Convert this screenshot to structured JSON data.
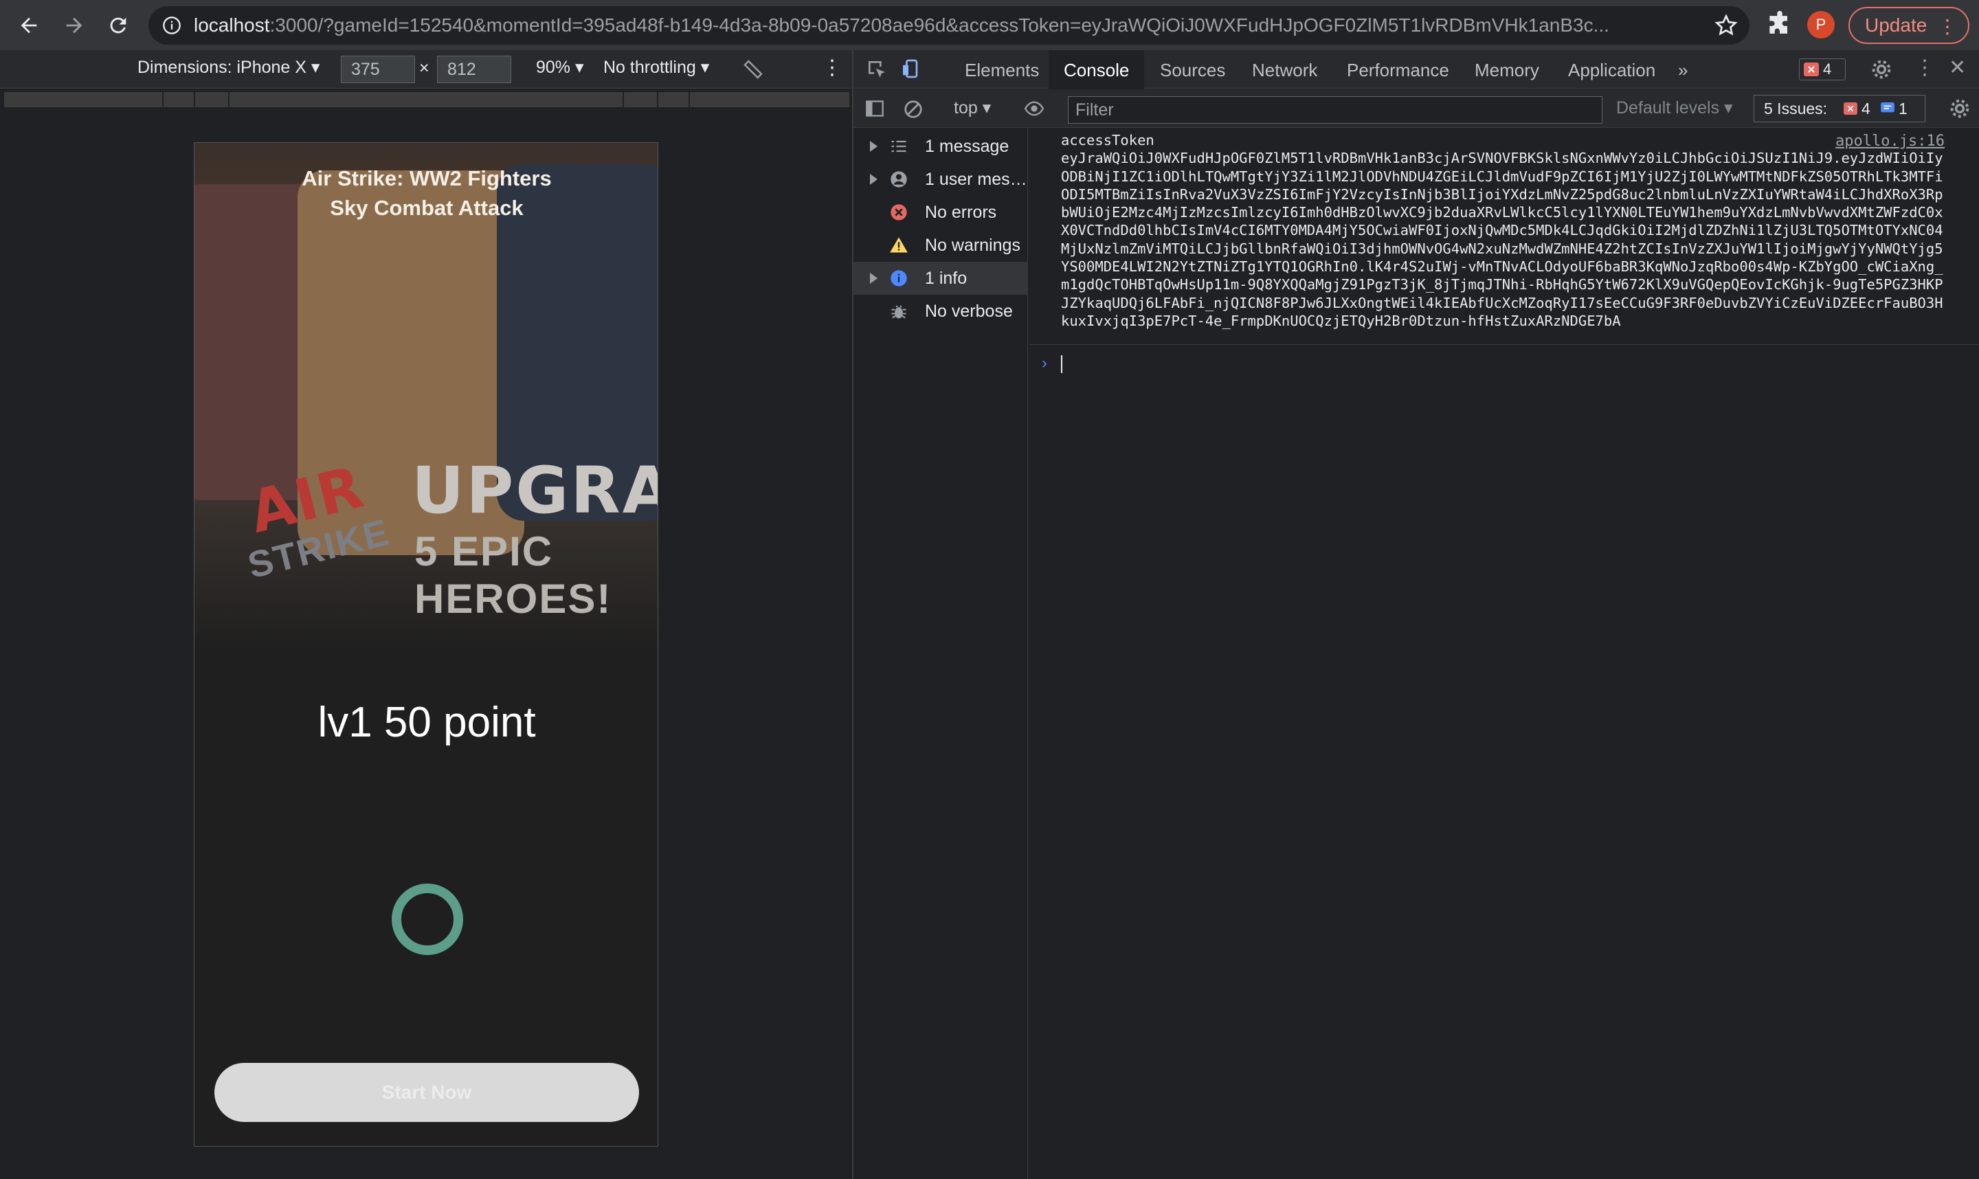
{
  "browser": {
    "url_host": "localhost",
    "url_rest": ":3000/?gameId=152540&momentId=395ad48f-b149-4d3a-8b09-0a57208ae96d&accessToken=eyJraWQiOiJ0WXFudHJpOGF0ZlM5T1lvRDBmVHk1anB3c...",
    "avatar_letter": "P",
    "update_label": "Update"
  },
  "device_toolbar": {
    "dimensions_label": "Dimensions: iPhone X ▾",
    "width_value": "375",
    "times": "×",
    "height_value": "812",
    "zoom": "90% ▾",
    "throttling": "No throttling ▾"
  },
  "game": {
    "title": "Air Strike: WW2 Fighters Sky Combat Attack",
    "logo_main": "AIR",
    "logo_sub": "STRIKE",
    "banner_line1": "UPGRADE",
    "banner_line2": "5 EPIC HEROES!",
    "level_text": "lv1 50 point",
    "start_button": "Start Now"
  },
  "devtools": {
    "tabs": [
      "Elements",
      "Console",
      "Sources",
      "Network",
      "Performance",
      "Memory",
      "Application"
    ],
    "more_tabs": "»",
    "error_badge": "4",
    "context": "top ▾",
    "filter_placeholder": "Filter",
    "default_levels": "Default levels ▾",
    "issues_label": "5 Issues:",
    "issues_errors": "4",
    "issues_info": "1",
    "sidebar": [
      {
        "label": "1 message"
      },
      {
        "label": "1 user mes…"
      },
      {
        "label": "No errors"
      },
      {
        "label": "No warnings"
      },
      {
        "label": "1 info"
      },
      {
        "label": "No verbose"
      }
    ],
    "log_source": "apollo.js:16",
    "log_text": "accessToken\neyJraWQiOiJ0WXFudHJpOGF0ZlM5T1lvRDBmVHk1anB3cjArSVNOVFBKSklsNGxnWWvYz0iLCJhbGciOiJSUzI1NiJ9.eyJzdWIiOiIyODBiNjI1ZC1iODlhLTQwMTgtYjY3Zi1lM2JlODVhNDU4ZGEiLCJldmVudF9pZCI6IjM1YjU2ZjI0LWYwMTMtNDFkZS05OTRhLTk3MTFiODI5MTBmZiIsInRva2VuX3VzZSI6ImFjY2VzcyIsInNjb3BlIjoiYXdzLmNvZ25pdG8uc2lnbmluLnVzZXIuYWRtaW4iLCJhdXRoX3RpbWUiOjE2Mzc4MjIzMzcsImlzcyI6Imh0dHBzOlwvXC9jb2duaXRvLWlkcC5lcy1lYXN0LTEuYW1hem9uYXdzLmNvbVwvdXMtZWFzdC0xX0VCTndDd0lhbCIsImV4cCI6MTY0MDA4MjY5OCwiaWF0IjoxNjQwMDc5MDk4LCJqdGkiOiI2MjdlZDZhNi1lZjU3LTQ5OTMtOTYxNC04MjUxNzlmZmViMTQiLCJjbGllbnRfaWQiOiI3djhmOWNvOG4wN2xuNzMwdWZmNHE4Z2htZCIsInVzZXJuYW1lIjoiMjgwYjYyNWQtYjg5YS00MDE4LWI2N2YtZTNiZTg1YTQ1OGRhIn0.lK4r4S2uIWj-vMnTNvACLOdyoUF6baBR3KqWNoJzqRbo00s4Wp-KZbYgOO_cWCiaXng_m1gdQcTOHBTqOwHsUp11m-9Q8YXQQaMgjZ91PgzT3jK_8jTjmqJTNhi-RbHqhG5YtW672KlX9uVGQepQEovIcKGhjk-9ugTe5PGZ3HKPJZYkaqUDQj6LFAbFi_njQICN8F8PJw6JLXxOngtWEil4kIEAbfUcXcMZoqRyI17sEeCCuG9F3RF0eDuvbZVYiCzEuViDZEEcrFauBO3HkuxIvxjqI3pE7PcT-4e_FrmpDKnUOCQzjETQyH2Br0Dtzun-hfHstZuxARzNDGE7bA",
    "prompt_symbol": "›"
  }
}
